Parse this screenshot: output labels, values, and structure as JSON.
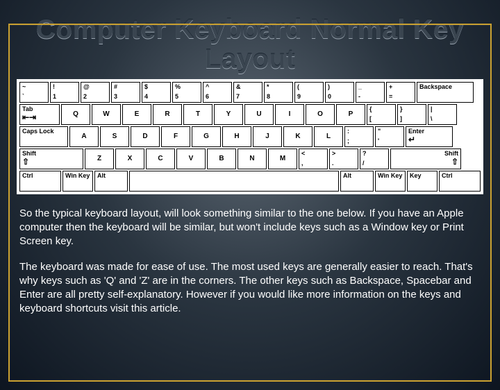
{
  "title": "Computer Keyboard Normal Key Layout",
  "keyboard": {
    "row1": [
      {
        "top": "~",
        "btm": "`"
      },
      {
        "top": "!",
        "btm": "1"
      },
      {
        "top": "@",
        "btm": "2"
      },
      {
        "top": "#",
        "btm": "3"
      },
      {
        "top": "$",
        "btm": "4"
      },
      {
        "top": "%",
        "btm": "5"
      },
      {
        "top": "^",
        "btm": "6"
      },
      {
        "top": "&",
        "btm": "7"
      },
      {
        "top": "*",
        "btm": "8"
      },
      {
        "top": "(",
        "btm": "9"
      },
      {
        "top": ")",
        "btm": "0"
      },
      {
        "top": "_",
        "btm": "-"
      },
      {
        "top": "+",
        "btm": "="
      }
    ],
    "backspace": "Backspace",
    "tab": "Tab",
    "row2": [
      "Q",
      "W",
      "E",
      "R",
      "T",
      "Y",
      "U",
      "I",
      "O",
      "P"
    ],
    "row2end": [
      {
        "top": "{",
        "btm": "["
      },
      {
        "top": "}",
        "btm": "]"
      },
      {
        "top": "|",
        "btm": "\\"
      }
    ],
    "caps": "Caps Lock",
    "row3": [
      "A",
      "S",
      "D",
      "F",
      "G",
      "H",
      "J",
      "K",
      "L"
    ],
    "row3end": [
      {
        "top": ":",
        "btm": ";"
      },
      {
        "top": "\"",
        "btm": "'"
      }
    ],
    "enter": "Enter",
    "shift": "Shift",
    "row4": [
      "Z",
      "X",
      "C",
      "V",
      "B",
      "N",
      "M"
    ],
    "row4end": [
      {
        "top": "<",
        "btm": ","
      },
      {
        "top": ">",
        "btm": "."
      },
      {
        "top": "?",
        "btm": "/"
      }
    ],
    "ctrl": "Ctrl",
    "win": "Win Key",
    "alt": "Alt",
    "key": "Key"
  },
  "para1": "So the typical keyboard layout, will look something similar to the one below. If you have an Apple computer then the keyboard will be similar, but won't include keys such as a Window key or Print Screen key.",
  "para2": "The keyboard was made for ease of use. The most used keys are generally easier to reach. That's why keys such as 'Q' and 'Z' are in the corners. The other keys such as Backspace, Spacebar and Enter are all pretty self-explanatory. However if you would like more information on the keys and keyboard shortcuts visit this article."
}
